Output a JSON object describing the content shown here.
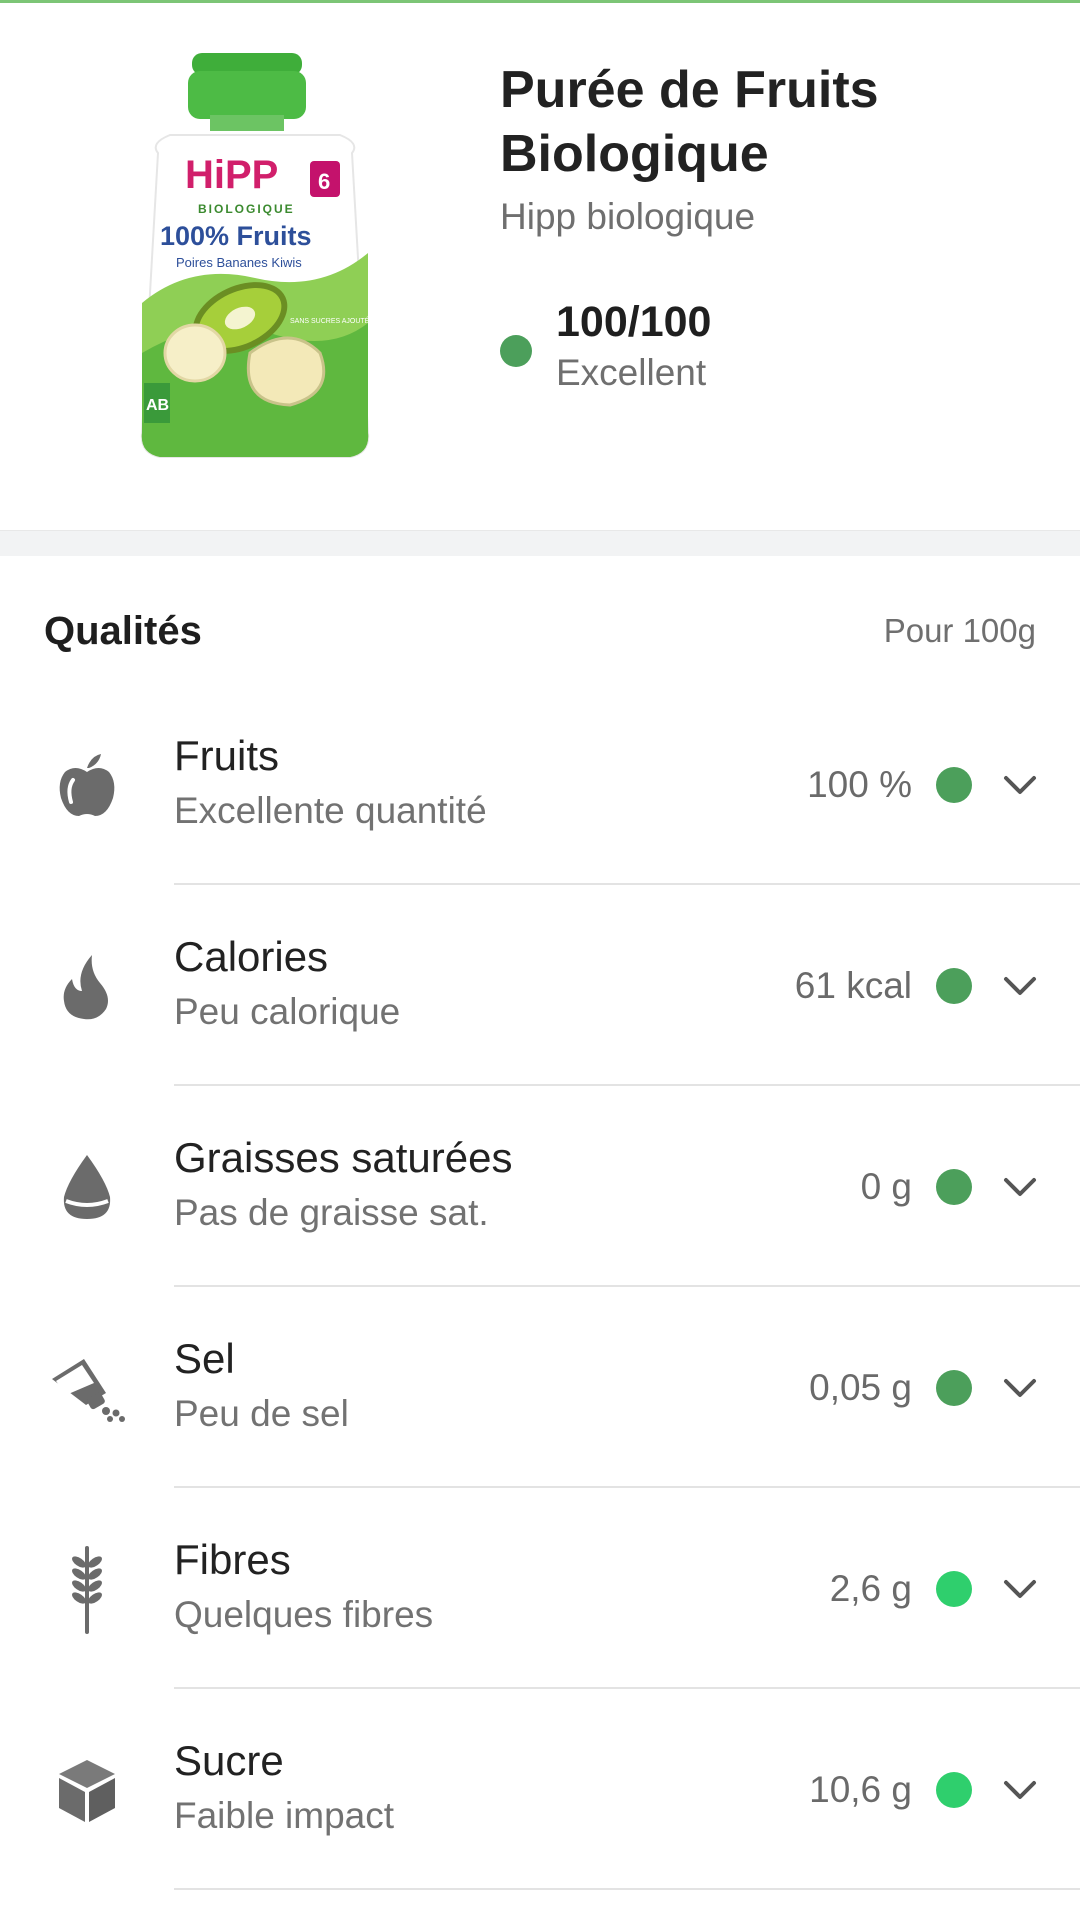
{
  "product": {
    "title": "Purée de Fruits Biologique",
    "brand": "Hipp biologique",
    "score_value": "100/100",
    "score_label": "Excellent",
    "score_color": "#4c9f5b",
    "package": {
      "brand_logo": "HiPP",
      "line": "BIOLOGIQUE",
      "headline": "100% Fruits",
      "flavour": "Poires Bananes Kiwis",
      "age_badge": "6",
      "seal": "AB",
      "claim": "SANS SUCRES AJOUTÉS"
    }
  },
  "qualities": {
    "title": "Qualités",
    "unit": "Pour 100g",
    "items": [
      {
        "icon": "apple-icon",
        "name": "Fruits",
        "desc": "Excellente quantité",
        "value": "100 %",
        "color": "#4c9f5b"
      },
      {
        "icon": "flame-icon",
        "name": "Calories",
        "desc": "Peu calorique",
        "value": "61 kcal",
        "color": "#4c9f5b"
      },
      {
        "icon": "drop-icon",
        "name": "Graisses saturées",
        "desc": "Pas de graisse sat.",
        "value": "0 g",
        "color": "#4c9f5b"
      },
      {
        "icon": "salt-shaker-icon",
        "name": "Sel",
        "desc": "Peu de sel",
        "value": "0,05 g",
        "color": "#4c9f5b"
      },
      {
        "icon": "wheat-icon",
        "name": "Fibres",
        "desc": "Quelques fibres",
        "value": "2,6 g",
        "color": "#2fcf6d"
      },
      {
        "icon": "sugar-cube-icon",
        "name": "Sucre",
        "desc": "Faible impact",
        "value": "10,6 g",
        "color": "#2fcf6d"
      }
    ]
  }
}
